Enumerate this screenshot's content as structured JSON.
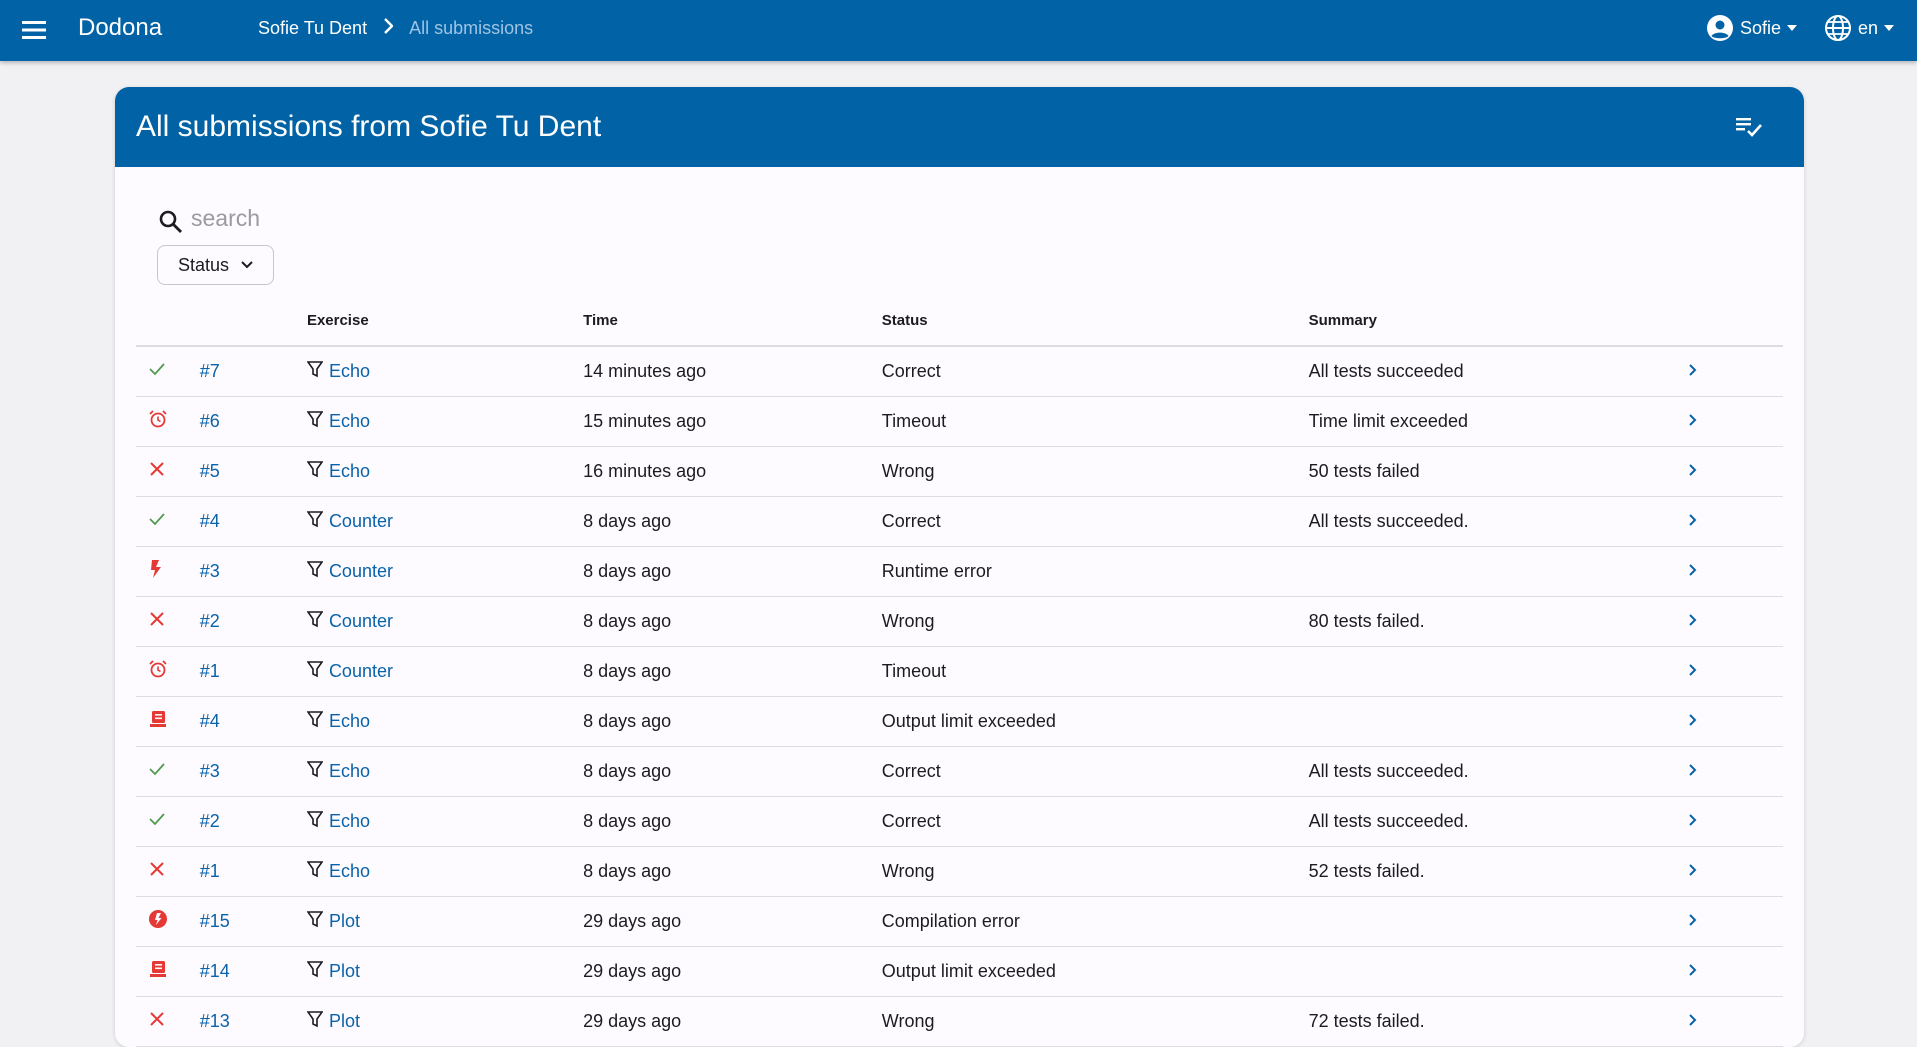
{
  "app": {
    "name": "Dodona"
  },
  "breadcrumb": {
    "user": "Sofie Tu Dent",
    "current": "All submissions"
  },
  "user_menu": {
    "name": "Sofie"
  },
  "lang_menu": {
    "code": "en"
  },
  "colors": {
    "primary": "#0163a6",
    "link": "#0a62a8",
    "success": "#4f9a4f",
    "error": "#e53935"
  },
  "card": {
    "title": "All submissions from Sofie Tu Dent"
  },
  "search": {
    "placeholder": "search",
    "value": ""
  },
  "filter": {
    "status_label": "Status"
  },
  "table": {
    "headers": {
      "exercise": "Exercise",
      "time": "Time",
      "status": "Status",
      "summary": "Summary"
    },
    "rows": [
      {
        "icon": "check-icon",
        "number": "#7",
        "exercise": "Echo",
        "time": "14 minutes ago",
        "status": "Correct",
        "summary": "All tests succeeded"
      },
      {
        "icon": "alarm-icon",
        "number": "#6",
        "exercise": "Echo",
        "time": "15 minutes ago",
        "status": "Timeout",
        "summary": "Time limit exceeded"
      },
      {
        "icon": "close-icon",
        "number": "#5",
        "exercise": "Echo",
        "time": "16 minutes ago",
        "status": "Wrong",
        "summary": "50 tests failed"
      },
      {
        "icon": "check-icon",
        "number": "#4",
        "exercise": "Counter",
        "time": "8 days ago",
        "status": "Correct",
        "summary": "All tests succeeded."
      },
      {
        "icon": "flash-icon",
        "number": "#3",
        "exercise": "Counter",
        "time": "8 days ago",
        "status": "Runtime error",
        "summary": ""
      },
      {
        "icon": "close-icon",
        "number": "#2",
        "exercise": "Counter",
        "time": "8 days ago",
        "status": "Wrong",
        "summary": "80 tests failed."
      },
      {
        "icon": "alarm-icon",
        "number": "#1",
        "exercise": "Counter",
        "time": "8 days ago",
        "status": "Timeout",
        "summary": ""
      },
      {
        "icon": "output-icon",
        "number": "#4",
        "exercise": "Echo",
        "time": "8 days ago",
        "status": "Output limit exceeded",
        "summary": ""
      },
      {
        "icon": "check-icon",
        "number": "#3",
        "exercise": "Echo",
        "time": "8 days ago",
        "status": "Correct",
        "summary": "All tests succeeded."
      },
      {
        "icon": "check-icon",
        "number": "#2",
        "exercise": "Echo",
        "time": "8 days ago",
        "status": "Correct",
        "summary": "All tests succeeded."
      },
      {
        "icon": "close-icon",
        "number": "#1",
        "exercise": "Echo",
        "time": "8 days ago",
        "status": "Wrong",
        "summary": "52 tests failed."
      },
      {
        "icon": "compile-error-icon",
        "number": "#15",
        "exercise": "Plot",
        "time": "29 days ago",
        "status": "Compilation error",
        "summary": ""
      },
      {
        "icon": "output-icon",
        "number": "#14",
        "exercise": "Plot",
        "time": "29 days ago",
        "status": "Output limit exceeded",
        "summary": ""
      },
      {
        "icon": "close-icon",
        "number": "#13",
        "exercise": "Plot",
        "time": "29 days ago",
        "status": "Wrong",
        "summary": "72 tests failed."
      }
    ]
  }
}
